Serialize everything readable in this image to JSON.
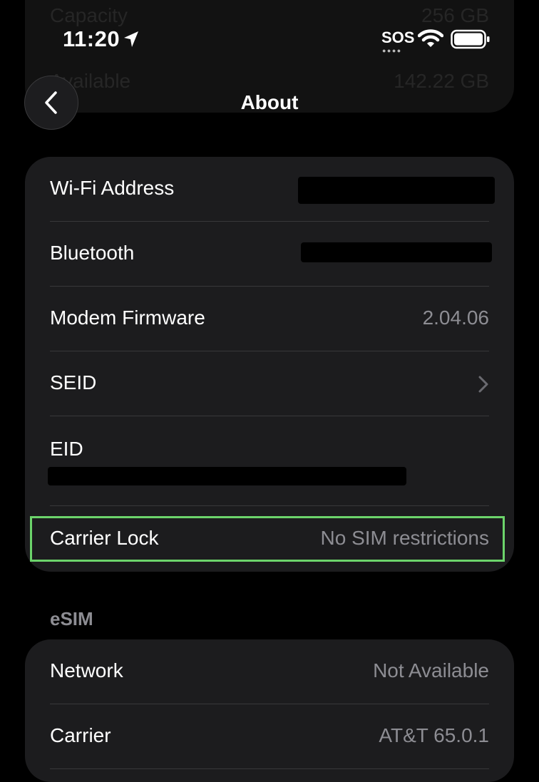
{
  "status_bar": {
    "time": "11:20",
    "sos": "SOS",
    "location_icon": "location-arrow-icon",
    "wifi_icon": "wifi-icon",
    "battery_icon": "battery-icon"
  },
  "background_card": {
    "rows": [
      {
        "label": "Capacity",
        "value": "256 GB"
      },
      {
        "label": "Available",
        "value": "142.22 GB"
      }
    ]
  },
  "nav": {
    "title": "About",
    "back_icon": "chevron-left-icon"
  },
  "about_rows": [
    {
      "label": "Wi-Fi Address",
      "value": "",
      "redacted": true
    },
    {
      "label": "Bluetooth",
      "value": "",
      "redacted": true
    },
    {
      "label": "Modem Firmware",
      "value": "2.04.06"
    },
    {
      "label": "SEID",
      "value": "",
      "disclosure_icon": "chevron-right-icon"
    },
    {
      "label": "EID",
      "value": "",
      "redacted": true
    },
    {
      "label": "Carrier Lock",
      "value": "No SIM restrictions",
      "highlighted": true
    }
  ],
  "esim": {
    "header": "eSIM",
    "rows": [
      {
        "label": "Network",
        "value": "Not Available"
      },
      {
        "label": "Carrier",
        "value": "AT&T 65.0.1"
      }
    ]
  },
  "colors": {
    "background": "#000000",
    "card": "#1c1c1e",
    "separator": "#38383a",
    "secondary_text": "#8d8d93",
    "highlight_border": "#6cd46b"
  }
}
